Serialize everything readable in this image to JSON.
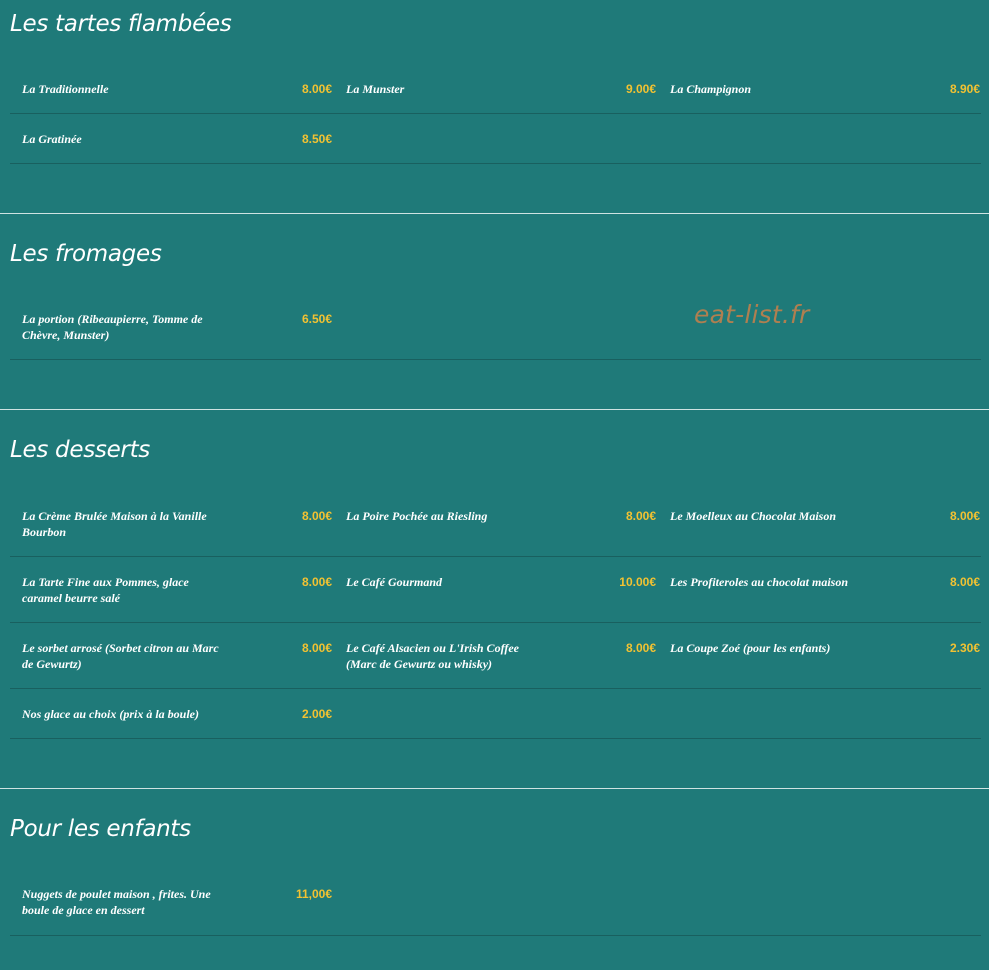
{
  "sections": [
    {
      "title": "Les tartes flambées",
      "items": [
        {
          "name": "La Traditionnelle",
          "price": "8.00€"
        },
        {
          "name": "La Munster",
          "price": "9.00€"
        },
        {
          "name": "La Champignon",
          "price": "8.90€"
        },
        {
          "name": "La Gratinée",
          "price": "8.50€"
        }
      ]
    },
    {
      "title": "Les fromages",
      "items": [
        {
          "name": "La portion (Ribeaupierre, Tomme de Chèvre, Munster)",
          "price": "6.50€"
        }
      ]
    },
    {
      "title": "Les desserts",
      "items": [
        {
          "name": "La Crème Brulée Maison à la Vanille Bourbon",
          "price": "8.00€"
        },
        {
          "name": "La Poire Pochée au Riesling",
          "price": "8.00€"
        },
        {
          "name": "Le Moelleux au Chocolat Maison",
          "price": "8.00€"
        },
        {
          "name": "La Tarte Fine aux Pommes, glace caramel beurre salé",
          "price": "8.00€"
        },
        {
          "name": "Le Café Gourmand",
          "price": "10.00€"
        },
        {
          "name": "Les Profiteroles au chocolat maison",
          "price": "8.00€"
        },
        {
          "name": "Le sorbet arrosé (Sorbet citron au Marc de Gewurtz)",
          "price": "8.00€"
        },
        {
          "name": "Le Café Alsacien ou L'Irish Coffee (Marc de Gewurtz ou whisky)",
          "price": "8.00€"
        },
        {
          "name": "La Coupe Zoé (pour les enfants)",
          "price": "2.30€"
        },
        {
          "name": "Nos glace au choix (prix à la boule)",
          "price": "2.00€"
        }
      ]
    },
    {
      "title": "Pour les enfants",
      "items": [
        {
          "name": "Nuggets de poulet maison , frites. Une boule de glace en dessert",
          "price": "11,00€"
        }
      ]
    }
  ],
  "watermark": "eat-list.fr",
  "colors": {
    "background": "#1f7a79",
    "price": "#f2c232",
    "watermark": "#c9814a"
  }
}
